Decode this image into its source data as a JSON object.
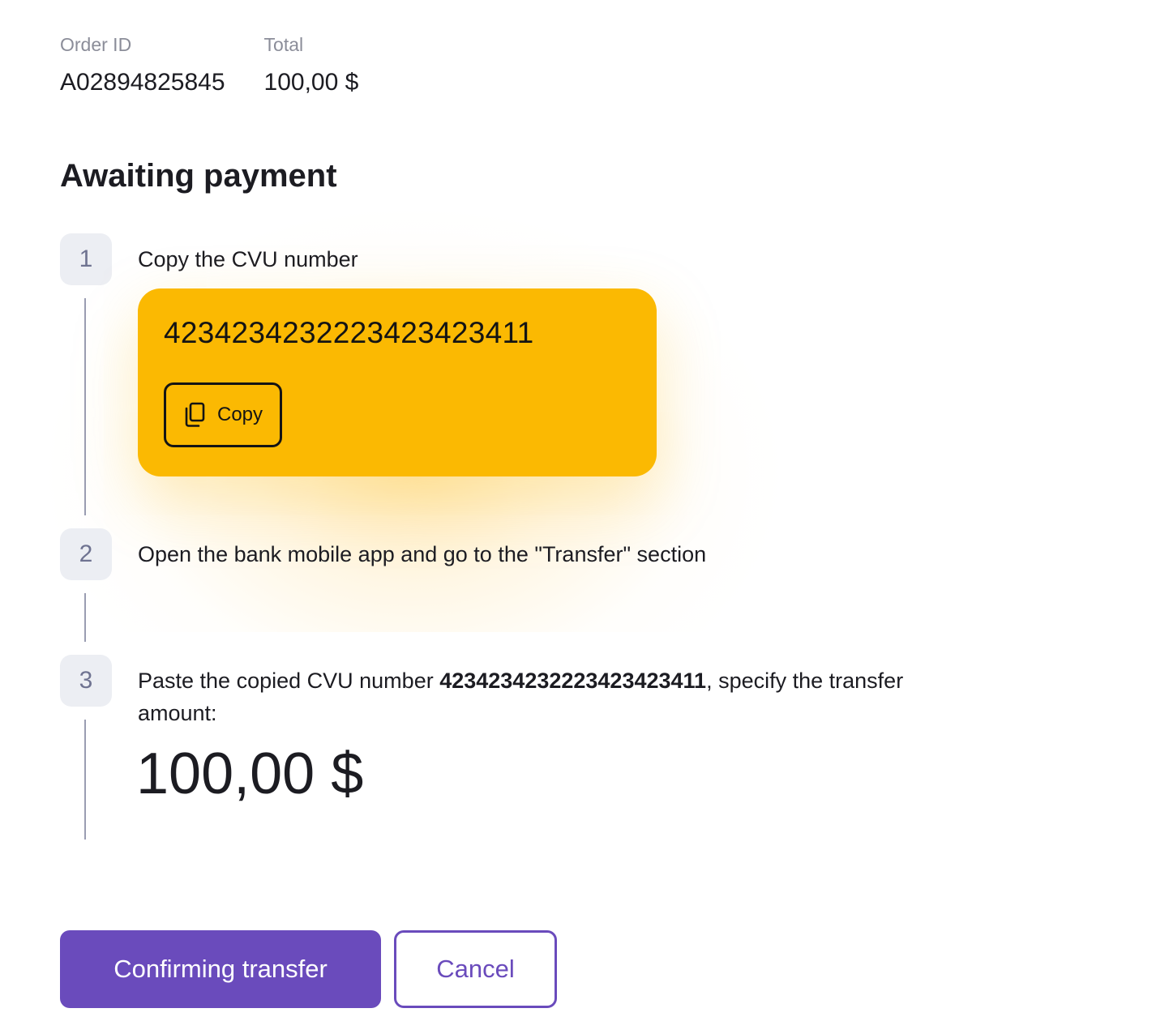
{
  "order": {
    "order_id_label": "Order ID",
    "order_id_value": "A02894825845",
    "total_label": "Total",
    "total_value": "100,00 $"
  },
  "title": "Awaiting payment",
  "steps": [
    {
      "number": "1",
      "text": "Copy the CVU number"
    },
    {
      "number": "2",
      "text": "Open the bank mobile app and go to the \"Transfer\" section"
    },
    {
      "number": "3",
      "text_before": "Paste the copied CVU number ",
      "text_bold": "4234234232223423423411",
      "text_after": ", specify the transfer amount:",
      "amount": "100,00 $"
    }
  ],
  "cvu_card": {
    "number": "4234234232223423423411",
    "copy_label": "Copy",
    "copy_icon": "copy-icon",
    "color": "#fbb902"
  },
  "actions": {
    "confirm_label": "Confirming transfer",
    "cancel_label": "Cancel",
    "accent": "#6a4bbc"
  }
}
